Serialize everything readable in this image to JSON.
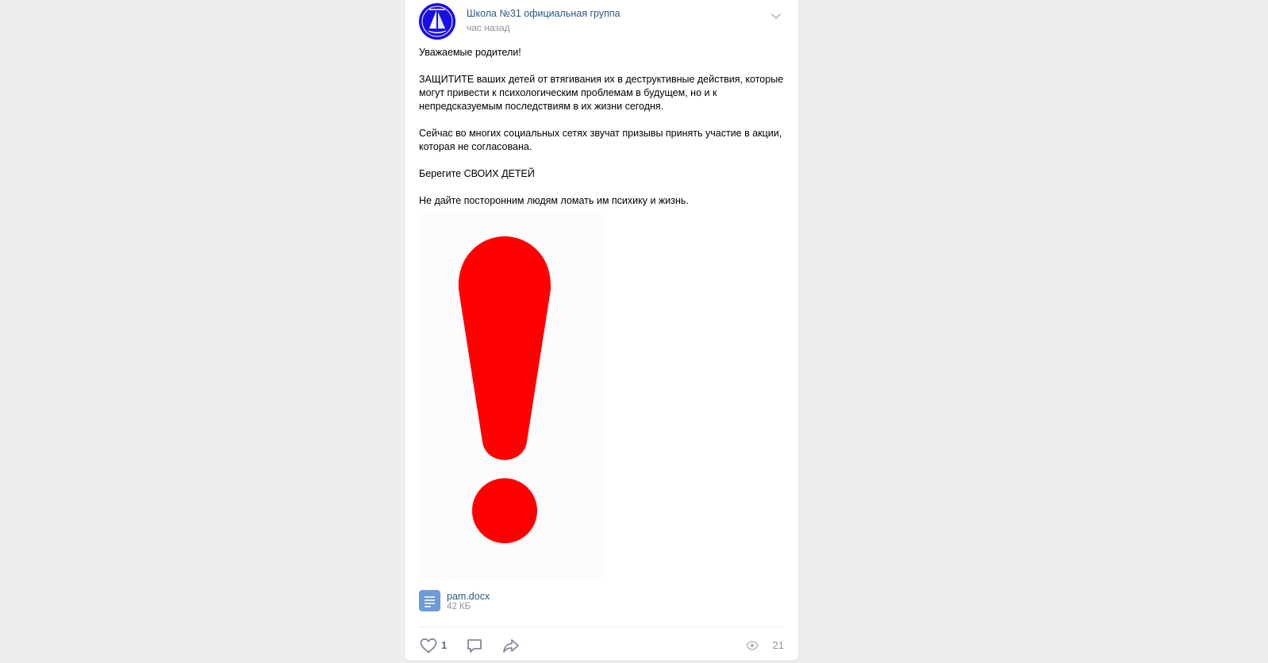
{
  "post": {
    "author": "Школа №31 официальная группа",
    "time": "час назад",
    "paragraphs": [
      "Уважаемые родители!",
      "ЗАЩИТИТЕ ваших детей от втягивания их в деструктивные действия, которые могут привести к психологическим проблемам в будущем, но и к непредсказуемым последствиям в их жизни сегодня.",
      "Сейчас во многих социальных сетях звучат призывы принять участие в акции, которая не согласована.",
      "Берегите СВОИХ ДЕТЕЙ",
      "Не дайте посторонним людям ломать им психику и жизнь."
    ],
    "image": {
      "icon": "red-exclamation-mark",
      "color": "#ff0000"
    },
    "attachment": {
      "name": "pam.docx",
      "size": "42 КБ",
      "icon": "document-icon"
    },
    "likes": "1",
    "views": "21"
  },
  "colors": {
    "background": "#edeef0",
    "card": "#ffffff",
    "link": "#2a5885",
    "muted": "#939393",
    "icon": "#828a99",
    "doc_icon": "#6f9ad6"
  }
}
